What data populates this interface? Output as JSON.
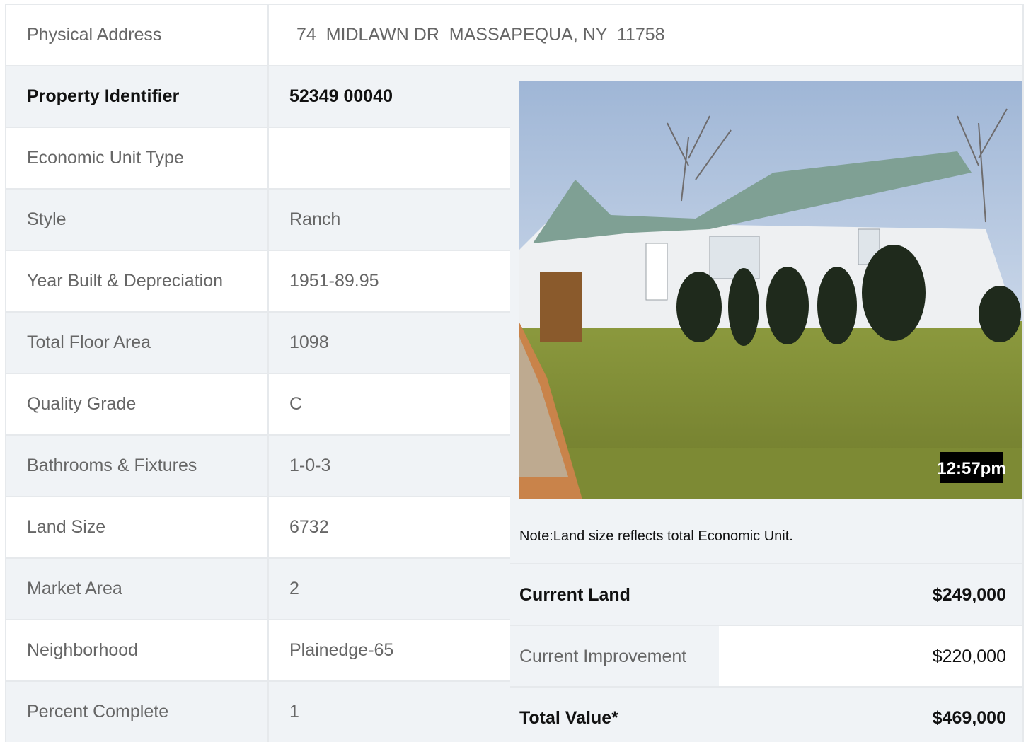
{
  "address": {
    "label": "Physical Address",
    "value": "74  MIDLAWN DR  MASSAPEQUA, NY  11758"
  },
  "details": [
    {
      "label": "Property Identifier",
      "value": "52349  00040"
    },
    {
      "label": "Economic Unit Type",
      "value": ""
    },
    {
      "label": "Style",
      "value": "Ranch"
    },
    {
      "label": "Year Built & Depreciation",
      "value": "1951-89.95"
    },
    {
      "label": "Total Floor Area",
      "value": "1098"
    },
    {
      "label": "Quality Grade",
      "value": "C"
    },
    {
      "label": "Bathrooms & Fixtures",
      "value": "1-0-3"
    },
    {
      "label": "Land Size",
      "value": "6732"
    },
    {
      "label": "Market Area",
      "value": "2"
    },
    {
      "label": "Neighborhood",
      "value": "Plainedge-65"
    },
    {
      "label": "Percent Complete",
      "value": "1"
    }
  ],
  "photo": {
    "timestamp": "12:57pm"
  },
  "note": "Note:Land size reflects total Economic Unit.",
  "values": [
    {
      "label": "Current Land",
      "value": "$249,000"
    },
    {
      "label": "Current Improvement",
      "value": "$220,000"
    },
    {
      "label": "Total Value*",
      "value": "$469,000"
    }
  ]
}
